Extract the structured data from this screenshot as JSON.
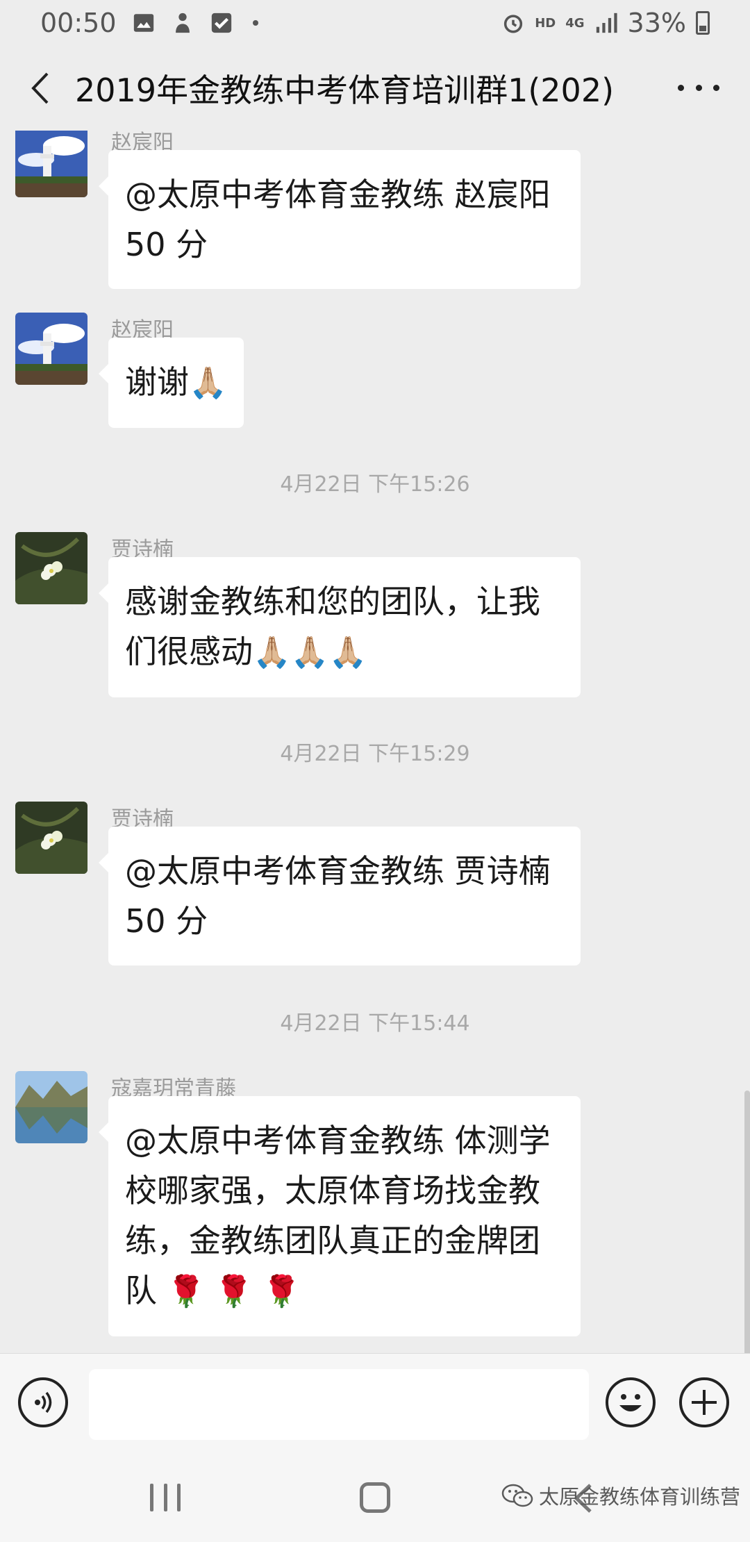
{
  "status_bar": {
    "time": "00:50",
    "network": "HD",
    "signal": "4G",
    "battery": "33%"
  },
  "header": {
    "title": "2019年金教练中考体育培训群1(202)"
  },
  "messages": [
    {
      "sender": "赵宸阳",
      "line1": "@太原中考体育金教练  赵宸阳",
      "line2": "50 分"
    },
    {
      "sender": "赵宸阳",
      "line1": "谢谢",
      "emoji": "🙏🏼"
    },
    {
      "sender": "贾诗楠",
      "line1": "感谢金教练和您的团队，让我",
      "line2": "们很感动",
      "emoji": "🙏🏼🙏🏼🙏🏼"
    },
    {
      "sender": "贾诗楠",
      "line1": "@太原中考体育金教练  贾诗楠",
      "line2": "50 分"
    },
    {
      "sender": "寇嘉玥常青藤",
      "line1": "@太原中考体育金教练 体测学",
      "line2": "校哪家强，太原体育场找金教",
      "line3": "练，金教练团队真正的金牌团",
      "line4": "队",
      "emoji": "🌹 🌹 🌹"
    }
  ],
  "timestamps": [
    "4月22日 下午15:26",
    "4月22日 下午15:29",
    "4月22日 下午15:44"
  ],
  "input": {
    "value": ""
  },
  "watermark": "太原金教练体育训练营",
  "icons": [
    "back-icon",
    "more-icon",
    "voice-icon",
    "emoji-icon",
    "plus-icon",
    "recent-apps-icon",
    "home-icon",
    "nav-back-icon",
    "wechat-logo-icon"
  ],
  "colors": {
    "background": "#ededed",
    "bubble": "#ffffff",
    "sender": "#9a9a9a",
    "timestamp": "#a8a8a8"
  }
}
